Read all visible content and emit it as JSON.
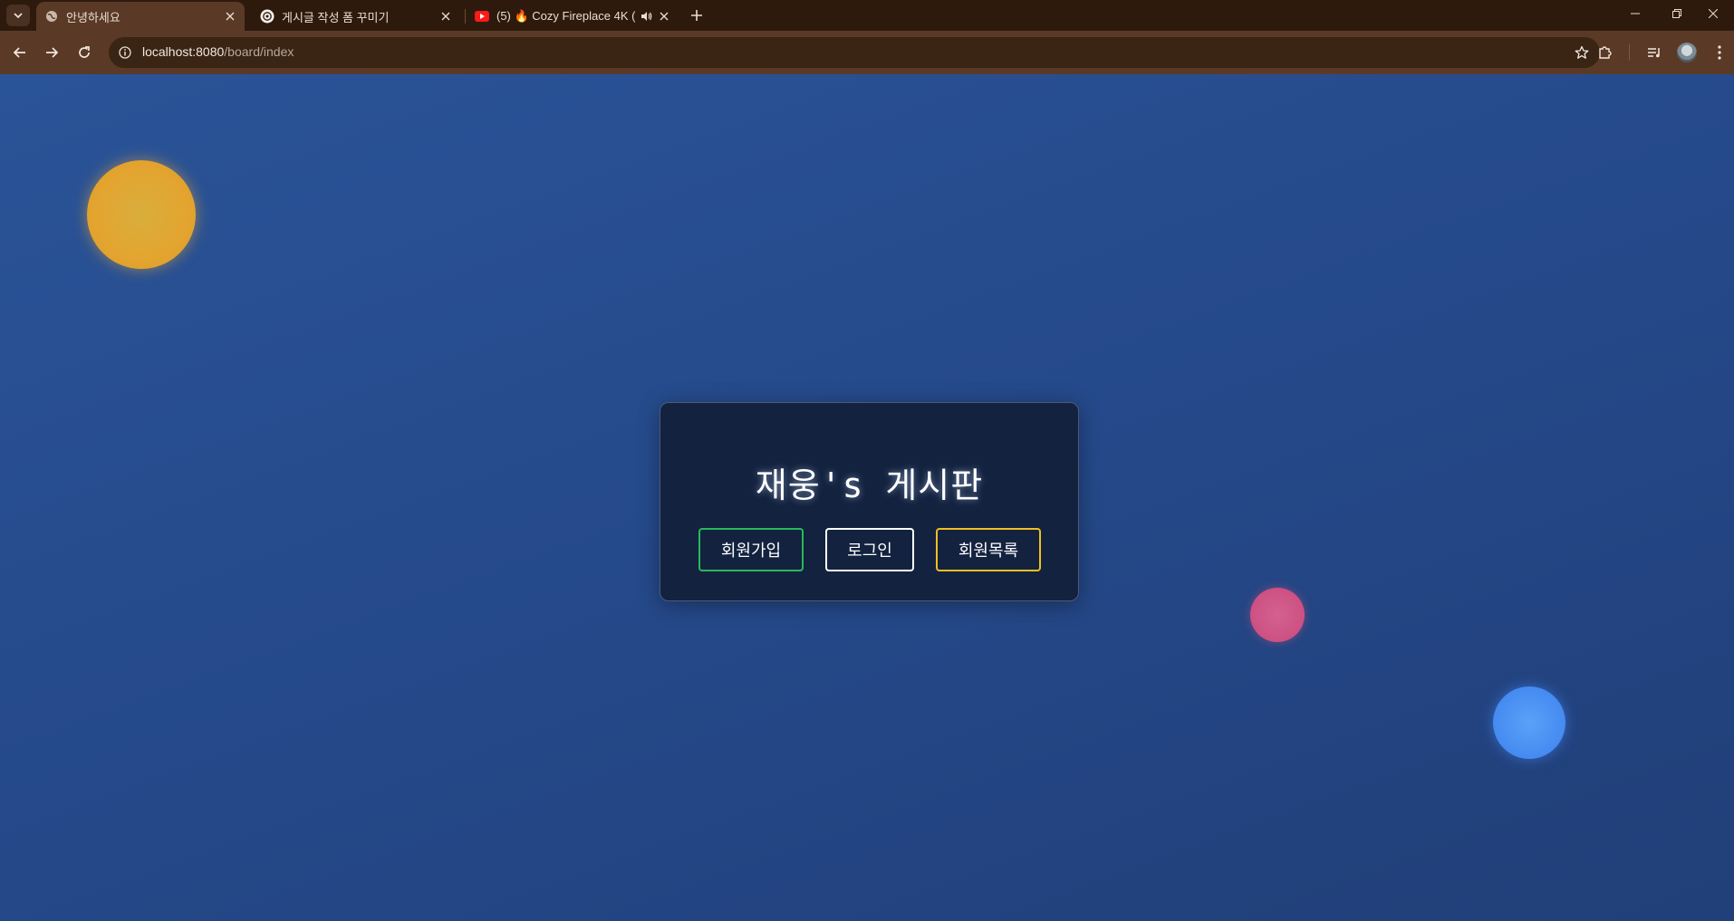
{
  "browser": {
    "tabs": [
      {
        "title": "안녕하세요",
        "active": true,
        "favicon": "globe-icon"
      },
      {
        "title": "게시글 작성 폼 꾸미기",
        "active": false,
        "favicon": "openai-icon"
      },
      {
        "title": "(5) 🔥 Cozy Fireplace 4K (",
        "active": false,
        "favicon": "youtube-icon",
        "audio": true
      }
    ],
    "address": {
      "host": "localhost:8080",
      "path": "/board/index"
    }
  },
  "page": {
    "title": "재웅's 게시판",
    "buttons": {
      "signup": "회원가입",
      "login": "로그인",
      "members": "회원목록"
    },
    "colors": {
      "background": "#25498a",
      "card": "#13223f",
      "signup_border": "#28b95a",
      "login_border": "#ffffff",
      "members_border": "#f0c020",
      "orb_yellow": "#e3a52f",
      "orb_pink": "#c94a7c",
      "orb_blue": "#3d80ee"
    }
  }
}
